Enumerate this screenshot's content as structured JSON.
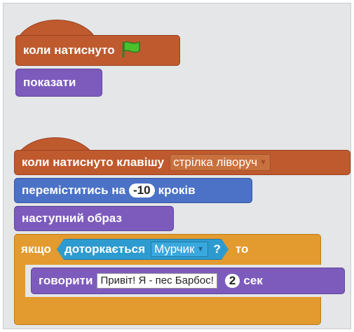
{
  "script1": {
    "hat_label": "коли натиснуто",
    "flag_icon": "green-flag-icon",
    "show_label": "показати"
  },
  "script2": {
    "hat_label": "коли натиснуто клавішу",
    "key_value": "стрілка ліворуч",
    "move_prefix": "переміститись на",
    "move_steps": "-10",
    "move_suffix": "кроків",
    "next_costume": "наступний образ",
    "if_label": "якщо",
    "then_label": "то",
    "touching_label": "доторкається",
    "touching_value": "Мурчик",
    "question_mark": "?",
    "say_label": "говорити",
    "say_text": "Привіт! Я - пес Барбос!",
    "say_secs": "2",
    "say_secs_label": "сек"
  },
  "colors": {
    "events": "#bf5a2e",
    "looks": "#7d5bbd",
    "motion": "#4b72c6",
    "control": "#e39a2e",
    "sensing": "#2e9bd0"
  }
}
